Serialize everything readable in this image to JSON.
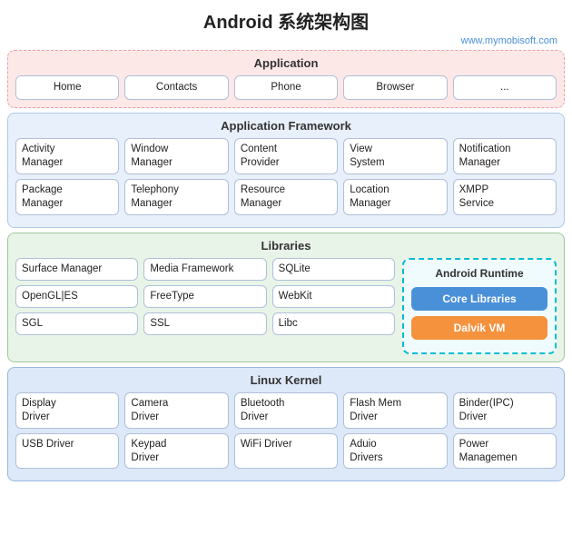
{
  "title": "Android 系统架构图",
  "watermark": "www.mymobisoft.com",
  "app_layer": {
    "title": "Application",
    "boxes": [
      "Home",
      "Contacts",
      "Phone",
      "Browser",
      "..."
    ]
  },
  "framework_layer": {
    "title": "Application Framework",
    "row1": [
      {
        "line1": "Activity",
        "line2": "Manager"
      },
      {
        "line1": "Window",
        "line2": "Manager"
      },
      {
        "line1": "Content",
        "line2": "Provider"
      },
      {
        "line1": "View",
        "line2": "System"
      },
      {
        "line1": "Notification",
        "line2": "Manager"
      }
    ],
    "row2": [
      {
        "line1": "Package",
        "line2": "Manager"
      },
      {
        "line1": "Telephony",
        "line2": "Manager"
      },
      {
        "line1": "Resource",
        "line2": "Manager"
      },
      {
        "line1": "Location",
        "line2": "Manager"
      },
      {
        "line1": "XMPP",
        "line2": "Service"
      }
    ]
  },
  "libraries_layer": {
    "title": "Libraries",
    "rows": [
      [
        "Surface Manager",
        "Media Framework",
        "SQLite"
      ],
      [
        "OpenGL|ES",
        "FreeType",
        "WebKit"
      ],
      [
        "SGL",
        "SSL",
        "Libc"
      ]
    ]
  },
  "android_runtime": {
    "title": "Android Runtime",
    "core_libraries": "Core Libraries",
    "dalvik_vm": "Dalvik VM"
  },
  "kernel_layer": {
    "title": "Linux Kernel",
    "row1": [
      {
        "line1": "Display",
        "line2": "Driver"
      },
      {
        "line1": "Camera",
        "line2": "Driver"
      },
      {
        "line1": "Bluetooth",
        "line2": "Driver"
      },
      {
        "line1": "Flash Mem",
        "line2": "Driver"
      },
      {
        "line1": "Binder(IPC)",
        "line2": "Driver"
      }
    ],
    "row2": [
      {
        "line1": "USB Driver",
        "line2": ""
      },
      {
        "line1": "Keypad",
        "line2": "Driver"
      },
      {
        "line1": "WiFi Driver",
        "line2": ""
      },
      {
        "line1": "Aduio",
        "line2": "Drivers"
      },
      {
        "line1": "Power",
        "line2": "Managemen"
      }
    ]
  }
}
